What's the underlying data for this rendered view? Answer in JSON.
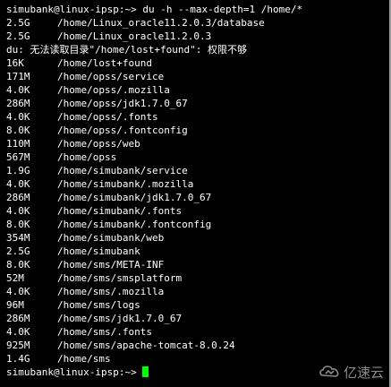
{
  "terminal": {
    "prompt": "simubank@linux-ipsp:~>",
    "command": " du -h --max-depth=1 /home/*",
    "lines": [
      {
        "type": "entry",
        "size": "2.5G",
        "path": "/home/Linux_oracle11.2.0.3/database"
      },
      {
        "type": "entry",
        "size": "2.5G",
        "path": "/home/Linux_oracle11.2.0.3"
      },
      {
        "type": "text",
        "text": "du: 无法读取目录\"/home/lost+found\": 权限不够"
      },
      {
        "type": "entry",
        "size": "16K",
        "path": "/home/lost+found"
      },
      {
        "type": "entry",
        "size": "171M",
        "path": "/home/opss/service"
      },
      {
        "type": "entry",
        "size": "4.0K",
        "path": "/home/opss/.mozilla"
      },
      {
        "type": "entry",
        "size": "286M",
        "path": "/home/opss/jdk1.7.0_67"
      },
      {
        "type": "entry",
        "size": "4.0K",
        "path": "/home/opss/.fonts"
      },
      {
        "type": "entry",
        "size": "8.0K",
        "path": "/home/opss/.fontconfig"
      },
      {
        "type": "entry",
        "size": "110M",
        "path": "/home/opss/web"
      },
      {
        "type": "entry",
        "size": "567M",
        "path": "/home/opss"
      },
      {
        "type": "entry",
        "size": "1.9G",
        "path": "/home/simubank/service"
      },
      {
        "type": "entry",
        "size": "4.0K",
        "path": "/home/simubank/.mozilla"
      },
      {
        "type": "entry",
        "size": "286M",
        "path": "/home/simubank/jdk1.7.0_67"
      },
      {
        "type": "entry",
        "size": "4.0K",
        "path": "/home/simubank/.fonts"
      },
      {
        "type": "entry",
        "size": "8.0K",
        "path": "/home/simubank/.fontconfig"
      },
      {
        "type": "entry",
        "size": "354M",
        "path": "/home/simubank/web"
      },
      {
        "type": "entry",
        "size": "2.5G",
        "path": "/home/simubank"
      },
      {
        "type": "entry",
        "size": "8.0K",
        "path": "/home/sms/META-INF"
      },
      {
        "type": "entry",
        "size": "52M",
        "path": "/home/sms/smsplatform"
      },
      {
        "type": "entry",
        "size": "4.0K",
        "path": "/home/sms/.mozilla"
      },
      {
        "type": "entry",
        "size": "96M",
        "path": "/home/sms/logs"
      },
      {
        "type": "entry",
        "size": "286M",
        "path": "/home/sms/jdk1.7.0_67"
      },
      {
        "type": "entry",
        "size": "4.0K",
        "path": "/home/sms/.fonts"
      },
      {
        "type": "entry",
        "size": "925M",
        "path": "/home/sms/apache-tomcat-8.0.24"
      },
      {
        "type": "entry",
        "size": "1.4G",
        "path": "/home/sms"
      }
    ],
    "final_prompt": "simubank@linux-ipsp:~>",
    "cursor_color": "#00ff00",
    "text_color": "#ffffff",
    "background": "#000000"
  },
  "watermark": {
    "text": "亿速云",
    "icon": "cloud-logo-icon"
  }
}
